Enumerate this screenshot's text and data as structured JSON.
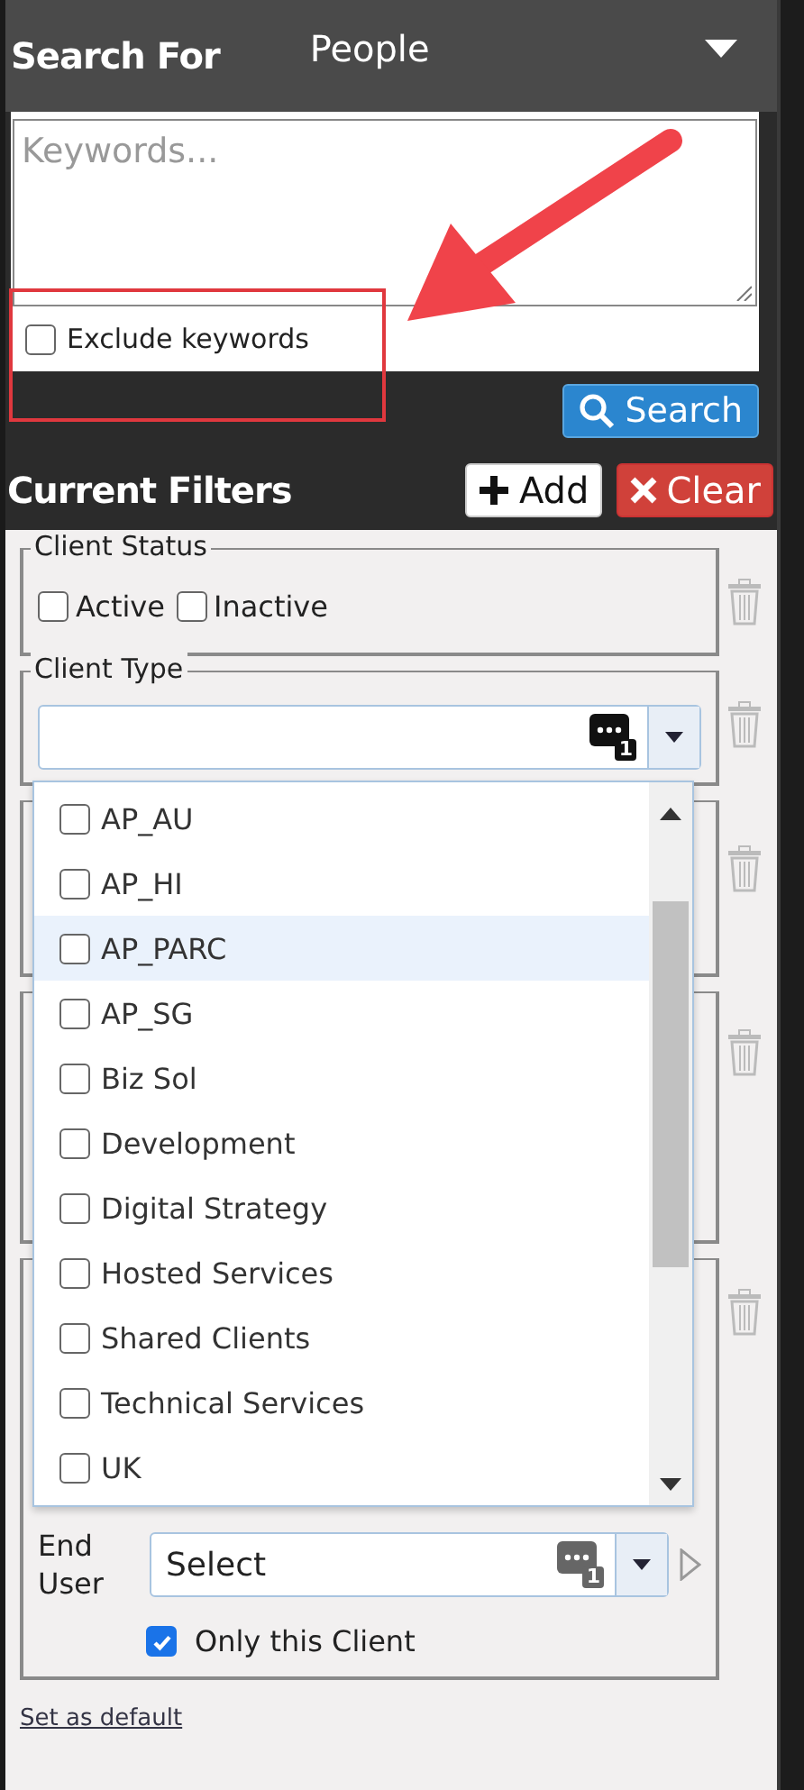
{
  "search": {
    "label": "Search For",
    "type": "People",
    "keywords_placeholder": "Keywords...",
    "exclude_keywords": {
      "label": "Exclude keywords",
      "checked": false
    },
    "button": "Search"
  },
  "filters": {
    "title": "Current Filters",
    "add_button": "Add",
    "clear_button": "Clear",
    "groups": [
      {
        "kind": "checkboxes",
        "legend": "Client Status",
        "options": [
          {
            "label": "Active",
            "checked": false
          },
          {
            "label": "Inactive",
            "checked": false
          }
        ]
      },
      {
        "kind": "combo",
        "legend": "Client Type",
        "count": "1"
      },
      {
        "kind": "blank"
      },
      {
        "kind": "tall"
      },
      {
        "kind": "client",
        "end_user": {
          "label": "End User",
          "value": "Select",
          "count": "1"
        },
        "only_this_client": {
          "label": "Only this Client",
          "checked": true
        }
      }
    ]
  },
  "dropdown": {
    "items": [
      {
        "label": "AP_AU",
        "checked": false,
        "highlighted": false
      },
      {
        "label": "AP_HI",
        "checked": false,
        "highlighted": false
      },
      {
        "label": "AP_PARC",
        "checked": false,
        "highlighted": true
      },
      {
        "label": "AP_SG",
        "checked": false,
        "highlighted": false
      },
      {
        "label": "Biz Sol",
        "checked": false,
        "highlighted": false
      },
      {
        "label": "Development",
        "checked": false,
        "highlighted": false
      },
      {
        "label": "Digital Strategy",
        "checked": false,
        "highlighted": false
      },
      {
        "label": "Hosted Services",
        "checked": false,
        "highlighted": false
      },
      {
        "label": "Shared Clients",
        "checked": false,
        "highlighted": false
      },
      {
        "label": "Technical Services",
        "checked": false,
        "highlighted": false
      },
      {
        "label": "UK",
        "checked": false,
        "highlighted": false
      }
    ]
  },
  "set_default": "Set as default"
}
